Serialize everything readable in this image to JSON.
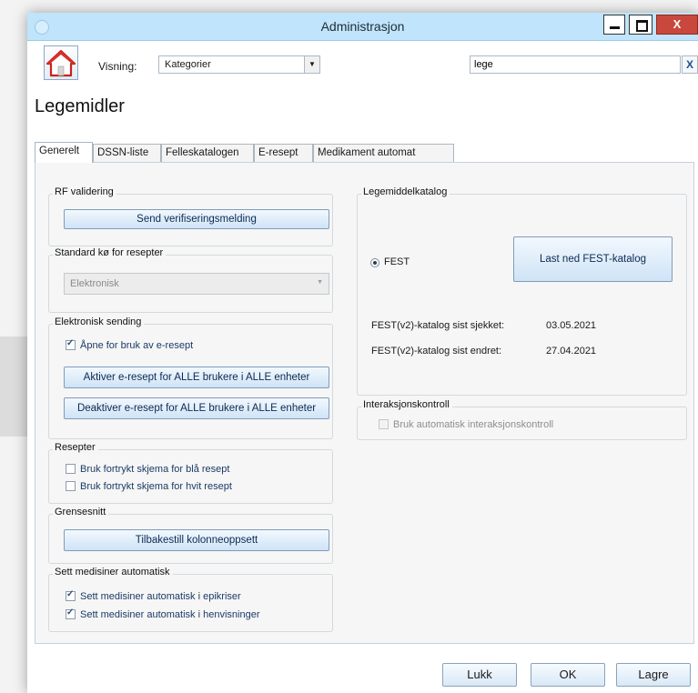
{
  "window": {
    "title": "Administrasjon",
    "close_label": "X"
  },
  "toolbar": {
    "visning_label": "Visning:",
    "visning_value": "Kategorier",
    "search_value": "lege",
    "search_clear": "X"
  },
  "page_title": "Legemidler",
  "tabs": [
    "Generelt",
    "DSSN-liste",
    "Felleskatalogen",
    "E-resept",
    "Medikament automat"
  ],
  "groups": {
    "rf": {
      "title": "RF validering",
      "button": "Send verifiseringsmelding"
    },
    "standard_ko": {
      "title": "Standard kø for resepter",
      "value": "Elektronisk"
    },
    "elektronisk": {
      "title": "Elektronisk sending",
      "checkbox": "Åpne for bruk av e-resept",
      "checked": true,
      "aktiver": "Aktiver e-resept for ALLE brukere i ALLE enheter",
      "deaktiver": "Deaktiver e-resept for ALLE brukere i ALLE enheter"
    },
    "resepter": {
      "title": "Resepter",
      "items": [
        "Bruk fortrykt skjema for blå resept",
        "Bruk fortrykt skjema for hvit resept"
      ]
    },
    "grensesnitt": {
      "title": "Grensesnitt",
      "button": "Tilbakestill kolonneoppsett"
    },
    "sett_medisiner": {
      "title": "Sett medisiner automatisk",
      "items": [
        "Sett medisiner automatisk i epikriser",
        "Sett medisiner automatisk i henvisninger"
      ]
    },
    "legemiddelkatalog": {
      "title": "Legemiddelkatalog",
      "radio_label": "FEST",
      "button": "Last ned FEST-katalog",
      "checked_label": "FEST(v2)-katalog sist sjekket:",
      "checked_value": "03.05.2021",
      "changed_label": "FEST(v2)-katalog sist endret:",
      "changed_value": "27.04.2021"
    },
    "interaksjon": {
      "title": "Interaksjonskontroll",
      "checkbox": "Bruk automatisk interaksjonskontroll"
    }
  },
  "footer": {
    "close": "Lukk",
    "ok": "OK",
    "save": "Lagre"
  },
  "colors": {
    "titlebar": "#bfe4fb",
    "close_button": "#c9483e",
    "accent_text": "#1b3a66"
  }
}
